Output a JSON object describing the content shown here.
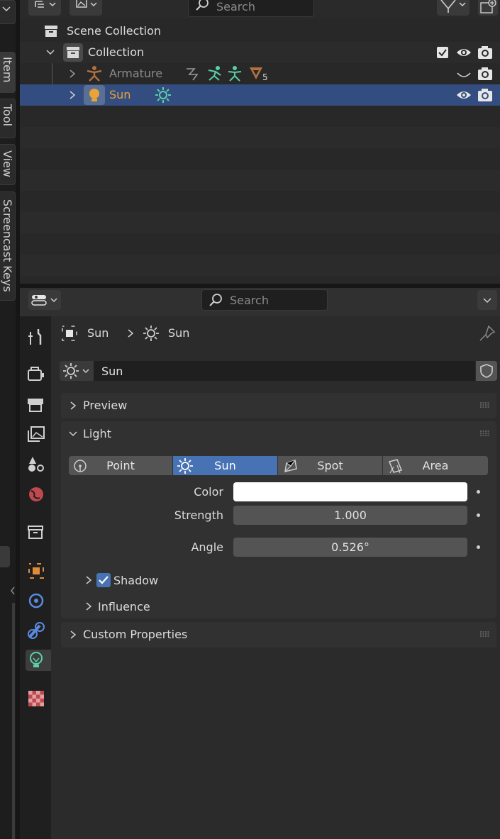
{
  "outliner": {
    "search_placeholder": "Search",
    "rows": [
      {
        "label": "Scene Collection"
      },
      {
        "label": "Collection"
      },
      {
        "label": "Armature",
        "modifier_count": "5"
      },
      {
        "label": "Sun"
      }
    ]
  },
  "side_tabs": [
    "Item",
    "Tool",
    "View",
    "Screencast Keys"
  ],
  "properties": {
    "search_placeholder": "Search",
    "breadcrumb": {
      "object": "Sun",
      "data": "Sun"
    },
    "datablock_name": "Sun",
    "panels": {
      "preview": "Preview",
      "light": "Light",
      "custom_properties": "Custom Properties"
    },
    "light_types": [
      "Point",
      "Sun",
      "Spot",
      "Area"
    ],
    "active_light_type": "Sun",
    "fields": {
      "color_label": "Color",
      "strength_label": "Strength",
      "strength_value": "1.000",
      "angle_label": "Angle",
      "angle_value": "0.526°"
    },
    "subpanels": {
      "shadow": "Shadow",
      "influence": "Influence"
    }
  },
  "colors": {
    "accent": "#4772b3",
    "selected_row": "#334d80",
    "sun_text": "#e8a33a",
    "light_green": "#5ad0a8"
  }
}
